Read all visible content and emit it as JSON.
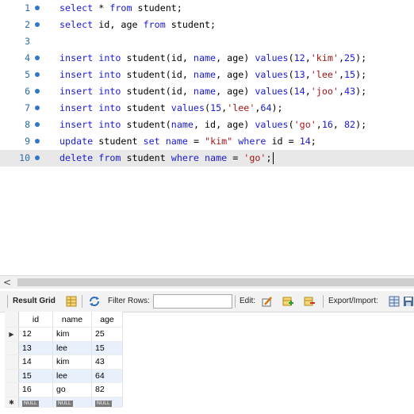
{
  "editor": {
    "lines": [
      {
        "num": "1",
        "segments": [
          {
            "t": "select",
            "c": "kw"
          },
          {
            "t": " * "
          },
          {
            "t": "from",
            "c": "kw"
          },
          {
            "t": " student;"
          }
        ]
      },
      {
        "num": "2",
        "segments": [
          {
            "t": "select",
            "c": "kw"
          },
          {
            "t": " id, age "
          },
          {
            "t": "from",
            "c": "kw"
          },
          {
            "t": " student;"
          }
        ]
      },
      {
        "num": "3",
        "segments": []
      },
      {
        "num": "4",
        "segments": [
          {
            "t": "insert",
            "c": "kw"
          },
          {
            "t": " "
          },
          {
            "t": "into",
            "c": "kw"
          },
          {
            "t": " student(id, "
          },
          {
            "t": "name",
            "c": "kw"
          },
          {
            "t": ", age) "
          },
          {
            "t": "values",
            "c": "kw"
          },
          {
            "t": "("
          },
          {
            "t": "12",
            "c": "num"
          },
          {
            "t": ","
          },
          {
            "t": "'kim'",
            "c": "str"
          },
          {
            "t": ","
          },
          {
            "t": "25",
            "c": "num"
          },
          {
            "t": ");"
          }
        ]
      },
      {
        "num": "5",
        "segments": [
          {
            "t": "insert",
            "c": "kw"
          },
          {
            "t": " "
          },
          {
            "t": "into",
            "c": "kw"
          },
          {
            "t": " student(id, "
          },
          {
            "t": "name",
            "c": "kw"
          },
          {
            "t": ", age) "
          },
          {
            "t": "values",
            "c": "kw"
          },
          {
            "t": "("
          },
          {
            "t": "13",
            "c": "num"
          },
          {
            "t": ","
          },
          {
            "t": "'lee'",
            "c": "str"
          },
          {
            "t": ","
          },
          {
            "t": "15",
            "c": "num"
          },
          {
            "t": ");"
          }
        ]
      },
      {
        "num": "6",
        "segments": [
          {
            "t": "insert",
            "c": "kw"
          },
          {
            "t": " "
          },
          {
            "t": "into",
            "c": "kw"
          },
          {
            "t": " student(id, "
          },
          {
            "t": "name",
            "c": "kw"
          },
          {
            "t": ", age) "
          },
          {
            "t": "values",
            "c": "kw"
          },
          {
            "t": "("
          },
          {
            "t": "14",
            "c": "num"
          },
          {
            "t": ","
          },
          {
            "t": "'joo'",
            "c": "str"
          },
          {
            "t": ","
          },
          {
            "t": "43",
            "c": "num"
          },
          {
            "t": ");"
          }
        ]
      },
      {
        "num": "7",
        "segments": [
          {
            "t": "insert",
            "c": "kw"
          },
          {
            "t": " "
          },
          {
            "t": "into",
            "c": "kw"
          },
          {
            "t": " student "
          },
          {
            "t": "values",
            "c": "kw"
          },
          {
            "t": "("
          },
          {
            "t": "15",
            "c": "num"
          },
          {
            "t": ","
          },
          {
            "t": "'lee'",
            "c": "str"
          },
          {
            "t": ","
          },
          {
            "t": "64",
            "c": "num"
          },
          {
            "t": ");"
          }
        ]
      },
      {
        "num": "8",
        "segments": [
          {
            "t": "insert",
            "c": "kw"
          },
          {
            "t": " "
          },
          {
            "t": "into",
            "c": "kw"
          },
          {
            "t": " student("
          },
          {
            "t": "name",
            "c": "kw"
          },
          {
            "t": ", id, age) "
          },
          {
            "t": "values",
            "c": "kw"
          },
          {
            "t": "("
          },
          {
            "t": "'go'",
            "c": "str"
          },
          {
            "t": ","
          },
          {
            "t": "16",
            "c": "num"
          },
          {
            "t": ", "
          },
          {
            "t": "82",
            "c": "num"
          },
          {
            "t": ");"
          }
        ]
      },
      {
        "num": "9",
        "segments": [
          {
            "t": "update",
            "c": "kw"
          },
          {
            "t": " student "
          },
          {
            "t": "set",
            "c": "kw"
          },
          {
            "t": " "
          },
          {
            "t": "name",
            "c": "kw"
          },
          {
            "t": " = "
          },
          {
            "t": "\"kim\"",
            "c": "str"
          },
          {
            "t": " "
          },
          {
            "t": "where",
            "c": "kw"
          },
          {
            "t": " id = "
          },
          {
            "t": "14",
            "c": "num"
          },
          {
            "t": ";"
          }
        ]
      },
      {
        "num": "10",
        "current": true,
        "segments": [
          {
            "t": "delete",
            "c": "kw"
          },
          {
            "t": " "
          },
          {
            "t": "from",
            "c": "kw"
          },
          {
            "t": " student "
          },
          {
            "t": "where",
            "c": "kw"
          },
          {
            "t": " "
          },
          {
            "t": "name",
            "c": "kw"
          },
          {
            "t": " = "
          },
          {
            "t": "'go'",
            "c": "str"
          },
          {
            "t": ";"
          }
        ]
      }
    ]
  },
  "scrollbar": {
    "left_arrow": "<"
  },
  "toolbar": {
    "result_grid_label": "Result Grid",
    "filter_rows_label": "Filter Rows:",
    "filter_value": "",
    "edit_label": "Edit:",
    "export_import_label": "Export/Import:"
  },
  "grid": {
    "columns": [
      "id",
      "name",
      "age"
    ],
    "rows": [
      [
        "12",
        "kim",
        "25"
      ],
      [
        "13",
        "lee",
        "15"
      ],
      [
        "14",
        "kim",
        "43"
      ],
      [
        "15",
        "lee",
        "64"
      ],
      [
        "16",
        "go",
        "82"
      ]
    ],
    "current_row_marker": "▶",
    "new_row_marker": "✱",
    "null_label": "NULL"
  }
}
